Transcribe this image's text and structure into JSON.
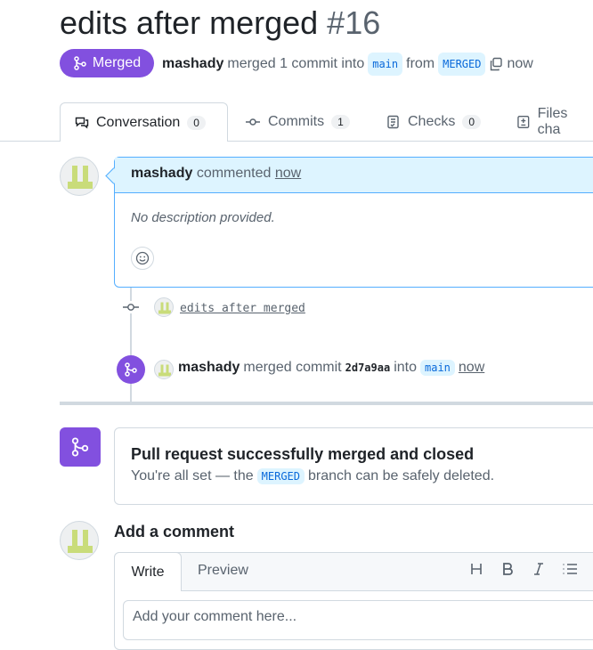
{
  "title": {
    "text": "edits after merged",
    "number": "#16"
  },
  "meta": {
    "state": "Merged",
    "author": "mashady",
    "action": "merged 1 commit into",
    "base_branch": "main",
    "from": "from",
    "head_branch": "MERGED",
    "time": "now"
  },
  "tabs": [
    {
      "label": "Conversation",
      "count": "0"
    },
    {
      "label": "Commits",
      "count": "1"
    },
    {
      "label": "Checks",
      "count": "0"
    },
    {
      "label": "Files cha"
    }
  ],
  "comment": {
    "author": "mashady",
    "action": "commented",
    "time": "now",
    "body": "No description provided."
  },
  "commit": {
    "message": "edits after merged"
  },
  "merge_event": {
    "author": "mashady",
    "action": "merged commit",
    "sha": "2d7a9aa",
    "into": "into",
    "branch": "main",
    "time": "now"
  },
  "merged_box": {
    "title": "Pull request successfully merged and closed",
    "prefix": "You're all set — the",
    "branch": "MERGED",
    "suffix": "branch can be safely deleted."
  },
  "add_comment": {
    "title": "Add a comment",
    "write": "Write",
    "preview": "Preview",
    "placeholder": "Add your comment here..."
  },
  "colors": {
    "merged": "#8250df",
    "accent": "#0969da",
    "highlight": "#ddf4ff"
  }
}
